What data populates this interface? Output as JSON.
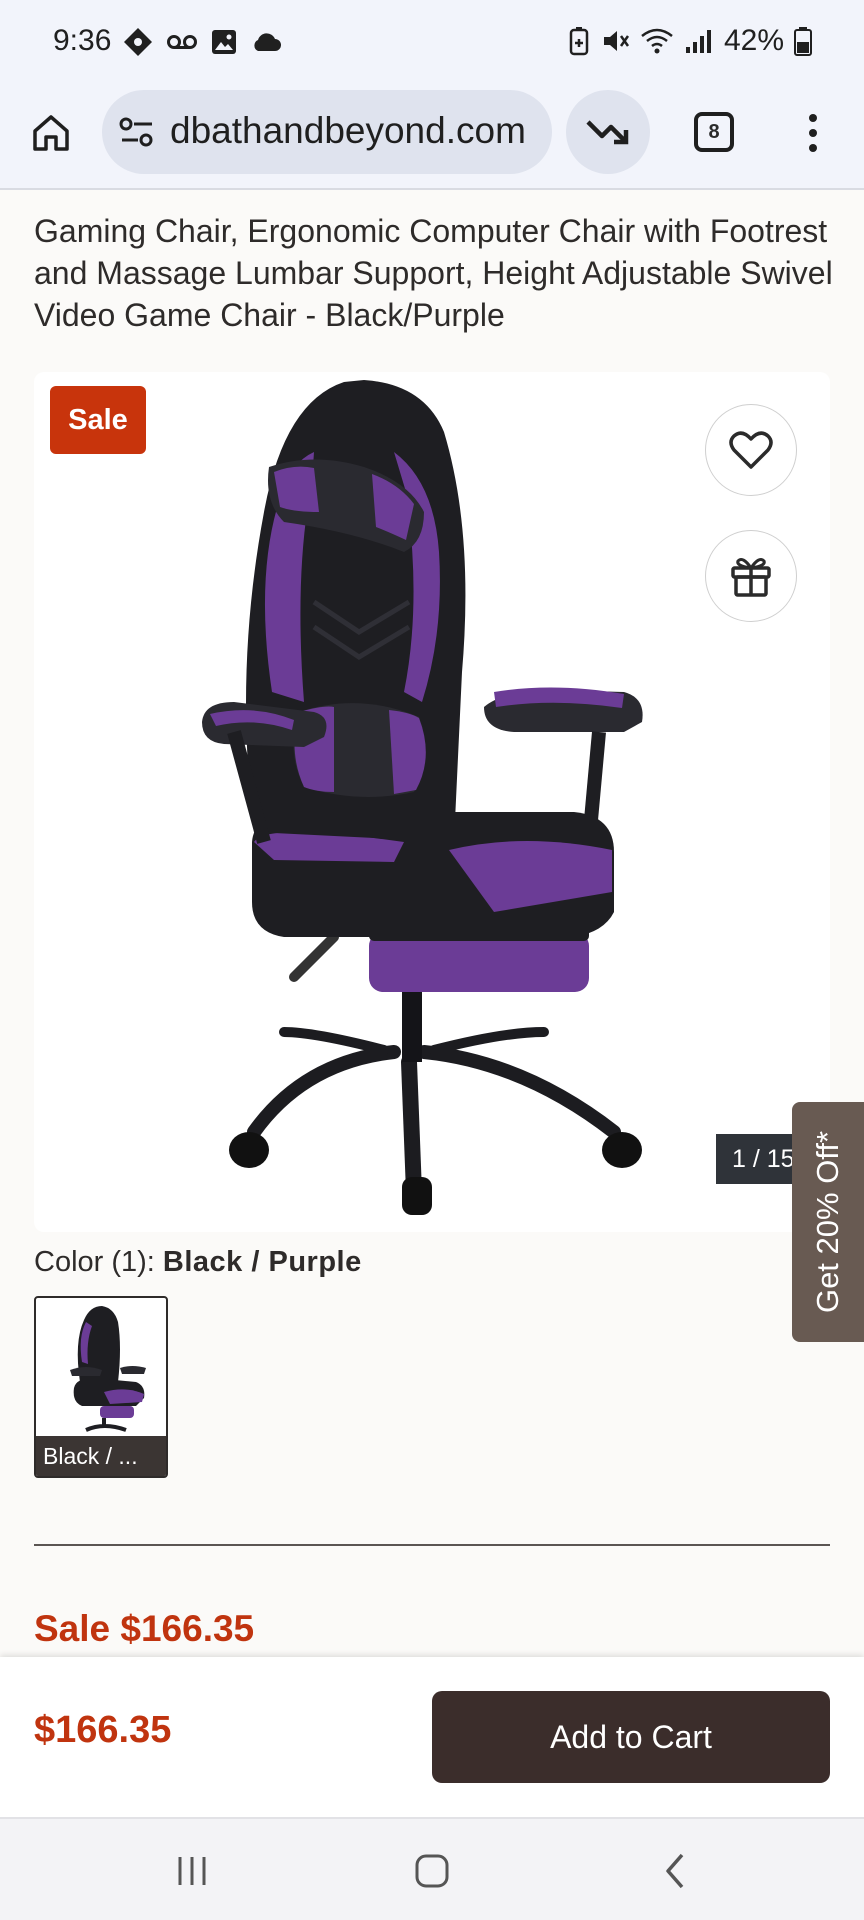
{
  "status_bar": {
    "time": "9:36",
    "battery": "42%",
    "left_icons": [
      "shop-tag-icon",
      "voicemail-icon",
      "image-icon",
      "cloud-icon"
    ],
    "right_icons": [
      "battery-saver-icon",
      "mute-icon",
      "wifi-icon",
      "signal-icon",
      "battery-icon"
    ]
  },
  "browser": {
    "url": "dbathandbeyond.com",
    "tab_count": "8"
  },
  "product": {
    "title": "Gaming Chair, Ergonomic Computer Chair with Footrest and Massage Lumbar Support, Height Adjustable Swivel Video Game Chair - Black/Purple",
    "sale_badge": "Sale",
    "image_counter": "1 / 15",
    "color_label": "Color (1): ",
    "color_value": "Black / Purple",
    "swatch_caption": "Black / ...",
    "sale_price": "Sale $166.35",
    "price": "$166.35"
  },
  "side_promo": {
    "label": "Get 20% Off*"
  },
  "actions": {
    "add_to_cart": "Add to Cart"
  },
  "colors": {
    "accent_red": "#c8340c",
    "button_dark": "#3b2d2b",
    "promo_tab": "#685a52",
    "chair_purple": "#6b3c96",
    "chair_black": "#1e1e22"
  }
}
